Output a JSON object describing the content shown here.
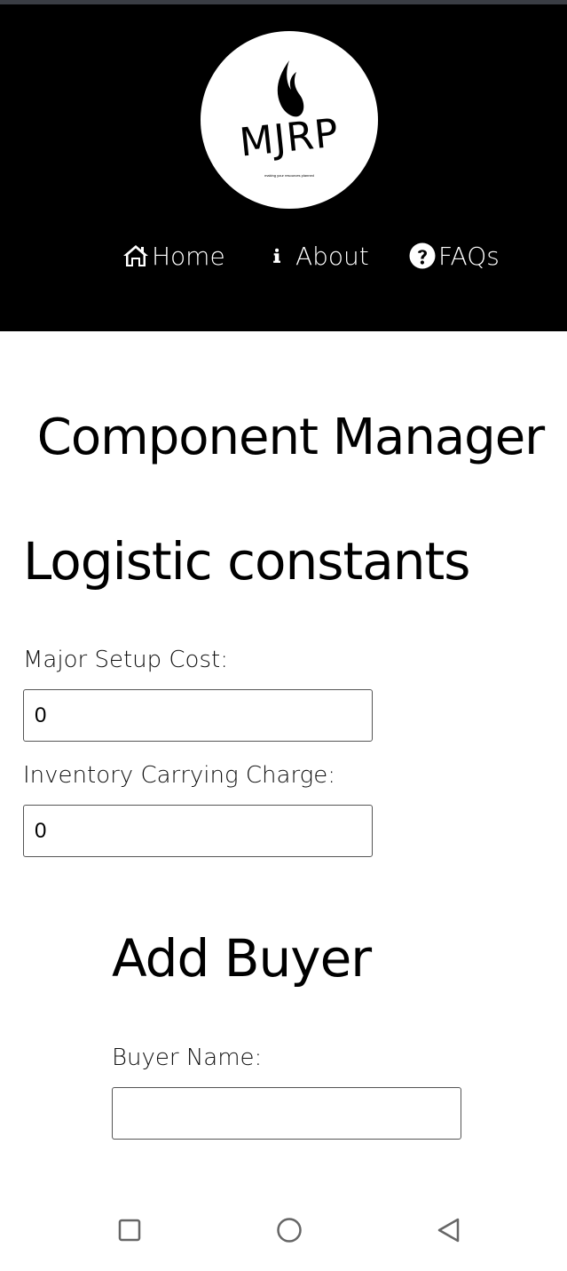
{
  "header": {
    "logo_text": "MJRP",
    "logo_tagline": "making your resources planned",
    "nav": [
      {
        "label": "Home",
        "icon": "home-icon"
      },
      {
        "label": "About",
        "icon": "info-icon"
      },
      {
        "label": "FAQs",
        "icon": "question-circle-icon"
      }
    ]
  },
  "main": {
    "page_title": "Component Manager",
    "logistic": {
      "title": "Logistic constants",
      "setup_label": "Major Setup Cost:",
      "setup_value": "0",
      "carrying_label": "Inventory Carrying Charge:",
      "carrying_value": "0"
    },
    "buyer": {
      "title": "Add Buyer",
      "name_label": "Buyer Name:",
      "name_value": ""
    }
  },
  "system_nav": {
    "icons": [
      "square-recents-icon",
      "circle-home-icon",
      "triangle-back-icon"
    ]
  },
  "colors": {
    "header_bg": "#000000",
    "page_bg": "#ffffff",
    "nav_text": "#ffffff",
    "system_icons": "#666666"
  }
}
